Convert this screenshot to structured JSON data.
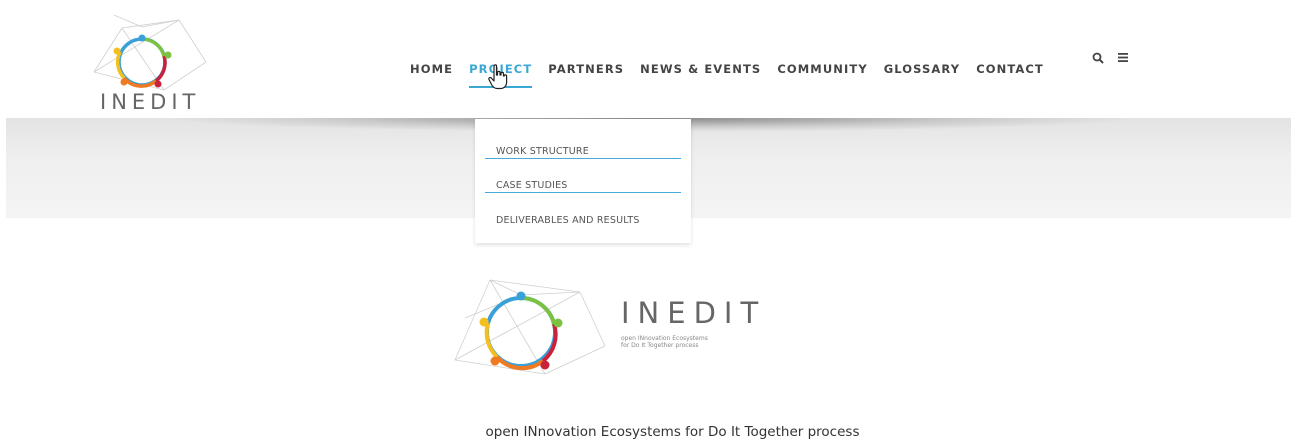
{
  "header": {
    "logo_text": "INEDIT",
    "nav": [
      {
        "label": "HOME"
      },
      {
        "label": "PROJECT",
        "active": true
      },
      {
        "label": "PARTNERS"
      },
      {
        "label": "NEWS & EVENTS"
      },
      {
        "label": "COMMUNITY"
      },
      {
        "label": "GLOSSARY"
      },
      {
        "label": "CONTACT"
      }
    ],
    "icons": {
      "search": "search-icon",
      "menu": "menu-icon"
    }
  },
  "dropdown": {
    "items": [
      {
        "label": "WORK STRUCTURE"
      },
      {
        "label": "CASE STUDIES"
      },
      {
        "label": "DELIVERABLES AND RESULTS"
      }
    ]
  },
  "hero": {
    "logo_text": "INEDIT",
    "logo_subtitle_line1": "open INnovation Ecosystems",
    "logo_subtitle_line2": "for Do It Together process",
    "tagline": "open INnovation Ecosystems for Do It Together process"
  },
  "colors": {
    "accent": "#3aa7d4",
    "logo_blue": "#3aa0d8",
    "logo_green": "#7cc242",
    "logo_yellow": "#f4c020",
    "logo_orange": "#f07a22",
    "logo_red": "#c8233a"
  }
}
